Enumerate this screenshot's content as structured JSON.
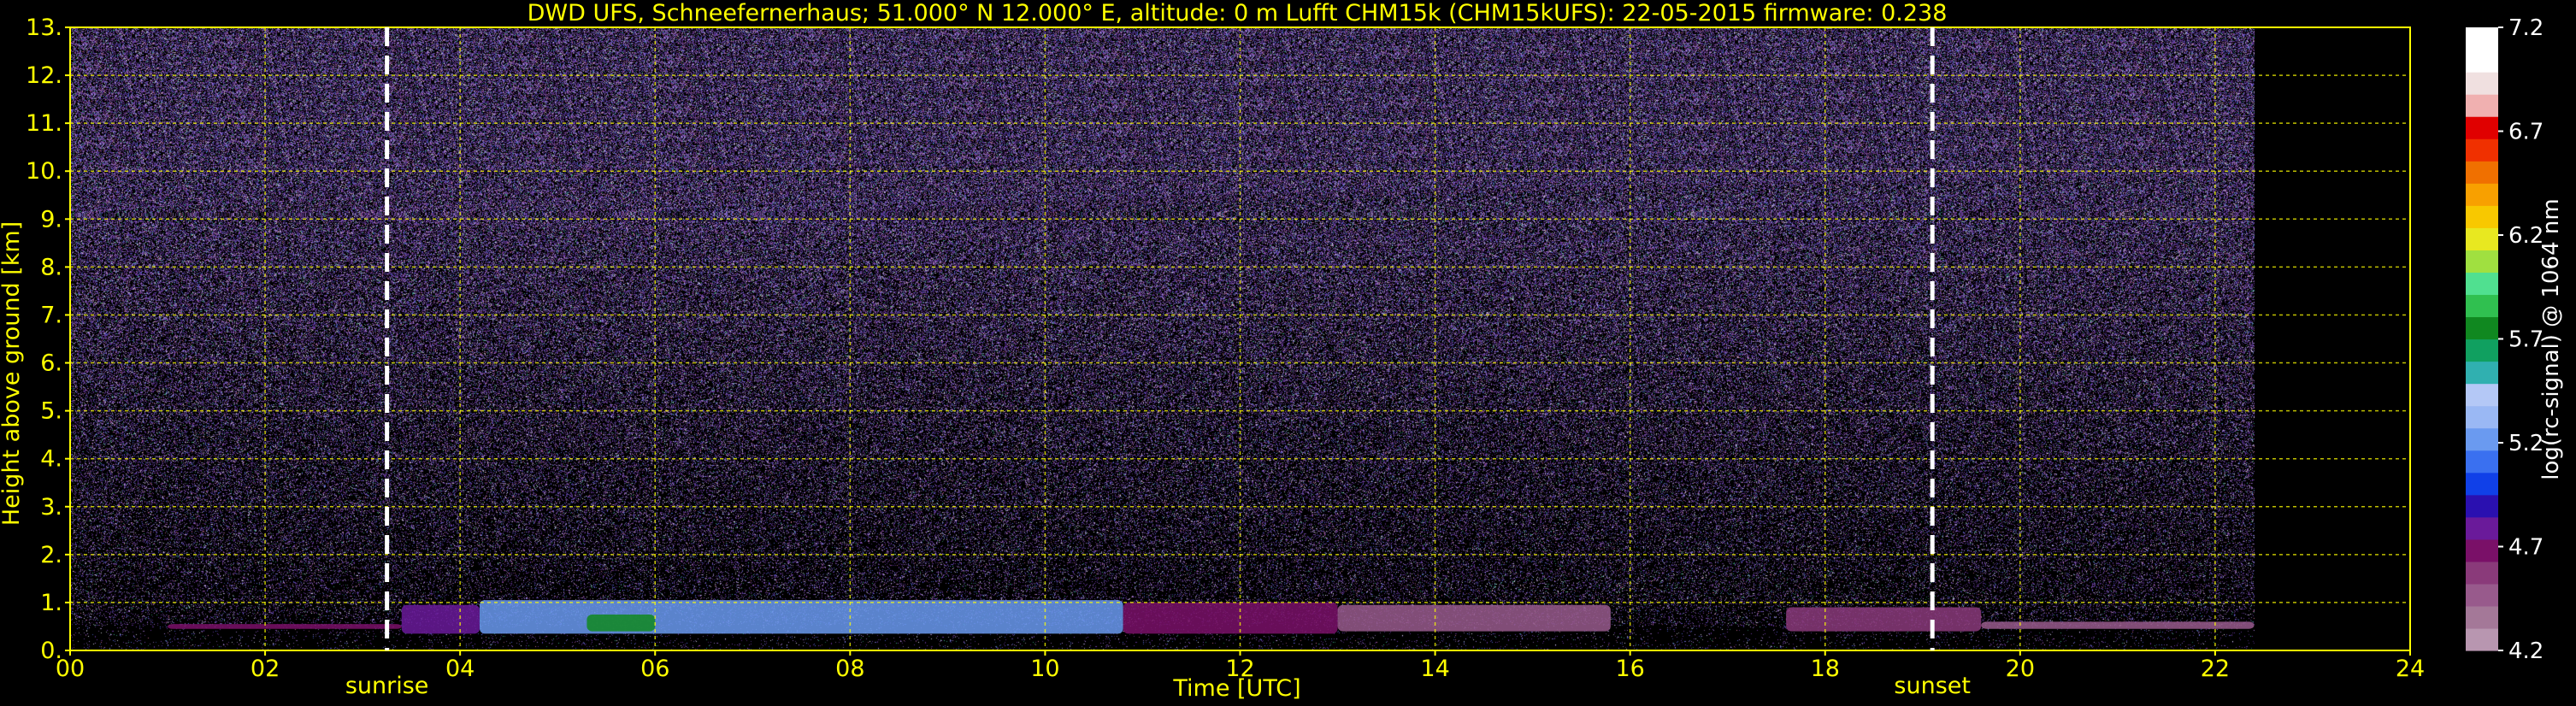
{
  "chart_data": {
    "type": "heatmap",
    "title": "DWD UFS, Schneefernerhaus; 51.000° N 12.000° E, altitude: 0 m    Lufft CHM15k (CHM15kUFS): 22-05-2015    firmware: 0.238",
    "xlabel": "Time [UTC]",
    "ylabel": "Height above ground [km]",
    "xlim": [
      0,
      24
    ],
    "ylim": [
      0,
      13
    ],
    "xticks": [
      "00",
      "02",
      "04",
      "06",
      "08",
      "10",
      "12",
      "14",
      "16",
      "18",
      "20",
      "22",
      "24"
    ],
    "yticks": [
      "0.",
      "1.",
      "2.",
      "3.",
      "4.",
      "5.",
      "6.",
      "7.",
      "8.",
      "9.",
      "10.",
      "11.",
      "12.",
      "13."
    ],
    "grid": true,
    "data_end_time": 22.4,
    "data_gap": [
      16.1,
      17.6
    ],
    "events": [
      {
        "label": "sunrise",
        "time": 3.25
      },
      {
        "label": "sunset",
        "time": 19.1
      }
    ],
    "layer_features": [
      {
        "start": 1.0,
        "end": 3.4,
        "base_km": 0.45,
        "top_km": 0.55,
        "level": 4.7
      },
      {
        "start": 3.4,
        "end": 4.2,
        "base_km": 0.35,
        "top_km": 0.95,
        "level": 4.8
      },
      {
        "start": 4.2,
        "end": 10.8,
        "base_km": 0.35,
        "top_km": 1.05,
        "level": 5.2
      },
      {
        "start": 5.3,
        "end": 6.0,
        "base_km": 0.4,
        "top_km": 0.75,
        "level": 5.7
      },
      {
        "start": 10.8,
        "end": 13.0,
        "base_km": 0.35,
        "top_km": 1.0,
        "level": 4.7
      },
      {
        "start": 13.0,
        "end": 15.8,
        "base_km": 0.4,
        "top_km": 0.95,
        "level": 4.5
      },
      {
        "start": 17.6,
        "end": 19.6,
        "base_km": 0.4,
        "top_km": 0.9,
        "level": 4.6
      },
      {
        "start": 19.6,
        "end": 22.4,
        "base_km": 0.45,
        "top_km": 0.6,
        "level": 4.5
      }
    ],
    "colorbar": {
      "label": "log(rc-signal) @ 1064 nm",
      "min": 4.2,
      "max": 7.2,
      "ticks": [
        "7.2",
        "6.7",
        "6.2",
        "5.7",
        "5.2",
        "4.7",
        "4.2"
      ],
      "colors": [
        "#b896b0",
        "#a47898",
        "#985a8c",
        "#8a3a7a",
        "#7a1068",
        "#6a1a9a",
        "#2a10b0",
        "#1040e8",
        "#3a70f0",
        "#6a9af0",
        "#9ab8f4",
        "#b4c8f6",
        "#30b0b0",
        "#10a060",
        "#108820",
        "#30c050",
        "#50e090",
        "#a0e040",
        "#e8e820",
        "#f8c800",
        "#f8a000",
        "#f07000",
        "#f03000",
        "#e00000",
        "#f0b0b0",
        "#f0e0e0",
        "#ffffff",
        "#ffffff"
      ]
    }
  }
}
